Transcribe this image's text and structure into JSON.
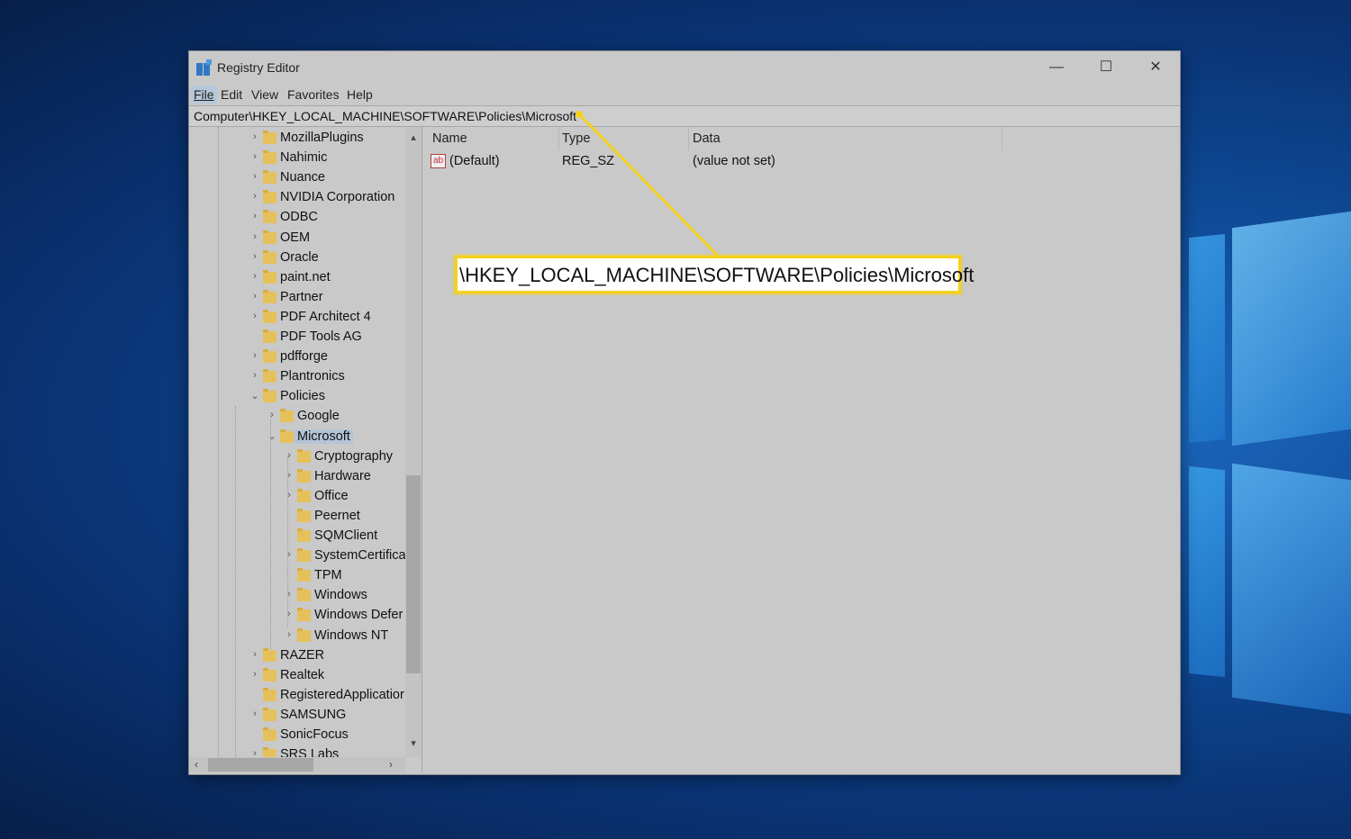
{
  "window": {
    "title": "Registry Editor",
    "controls": {
      "minimize": "—",
      "maximize": "☐",
      "close": "✕"
    }
  },
  "menu": [
    "File",
    "Edit",
    "View",
    "Favorites",
    "Help"
  ],
  "address_bar": {
    "path": "Computer\\HKEY_LOCAL_MACHINE\\SOFTWARE\\Policies\\Microsoft"
  },
  "tree": {
    "nodes": [
      {
        "label": "MozillaPlugins",
        "depth": 0,
        "chevron": "›"
      },
      {
        "label": "Nahimic",
        "depth": 0,
        "chevron": "›"
      },
      {
        "label": "Nuance",
        "depth": 0,
        "chevron": "›"
      },
      {
        "label": "NVIDIA Corporation",
        "depth": 0,
        "chevron": "›"
      },
      {
        "label": "ODBC",
        "depth": 0,
        "chevron": "›"
      },
      {
        "label": "OEM",
        "depth": 0,
        "chevron": "›"
      },
      {
        "label": "Oracle",
        "depth": 0,
        "chevron": "›"
      },
      {
        "label": "paint.net",
        "depth": 0,
        "chevron": "›"
      },
      {
        "label": "Partner",
        "depth": 0,
        "chevron": "›"
      },
      {
        "label": "PDF Architect 4",
        "depth": 0,
        "chevron": "›"
      },
      {
        "label": "PDF Tools AG",
        "depth": 0,
        "chevron": ""
      },
      {
        "label": "pdfforge",
        "depth": 0,
        "chevron": "›"
      },
      {
        "label": "Plantronics",
        "depth": 0,
        "chevron": "›"
      },
      {
        "label": "Policies",
        "depth": 0,
        "chevron": "⌄"
      },
      {
        "label": "Google",
        "depth": 1,
        "chevron": "›"
      },
      {
        "label": "Microsoft",
        "depth": 1,
        "chevron": "⌄",
        "selected": true
      },
      {
        "label": "Cryptography",
        "depth": 2,
        "chevron": "›"
      },
      {
        "label": "Hardware",
        "depth": 2,
        "chevron": "›"
      },
      {
        "label": "Office",
        "depth": 2,
        "chevron": "›"
      },
      {
        "label": "Peernet",
        "depth": 2,
        "chevron": ""
      },
      {
        "label": "SQMClient",
        "depth": 2,
        "chevron": ""
      },
      {
        "label": "SystemCertifica",
        "depth": 2,
        "chevron": "›"
      },
      {
        "label": "TPM",
        "depth": 2,
        "chevron": ""
      },
      {
        "label": "Windows",
        "depth": 2,
        "chevron": "›"
      },
      {
        "label": "Windows Defer",
        "depth": 2,
        "chevron": "›"
      },
      {
        "label": "Windows NT",
        "depth": 2,
        "chevron": "›"
      },
      {
        "label": "RAZER",
        "depth": 0,
        "chevron": "›"
      },
      {
        "label": "Realtek",
        "depth": 0,
        "chevron": "›"
      },
      {
        "label": "RegisteredApplicatior",
        "depth": 0,
        "chevron": ""
      },
      {
        "label": "SAMSUNG",
        "depth": 0,
        "chevron": "›"
      },
      {
        "label": "SonicFocus",
        "depth": 0,
        "chevron": ""
      },
      {
        "label": "SRS Labs",
        "depth": 0,
        "chevron": "›"
      }
    ],
    "scroll_up": "▴",
    "scroll_down": "▾",
    "hscroll_left": "‹",
    "hscroll_right": "›"
  },
  "values_pane": {
    "columns": [
      "Name",
      "Type",
      "Data"
    ],
    "rows": [
      {
        "icon": "ab",
        "name": "(Default)",
        "type": "REG_SZ",
        "data": "(value not set)"
      }
    ]
  },
  "callout": {
    "text": "\\HKEY_LOCAL_MACHINE\\SOFTWARE\\Policies\\Microsoft",
    "color": "#f5d11b"
  }
}
